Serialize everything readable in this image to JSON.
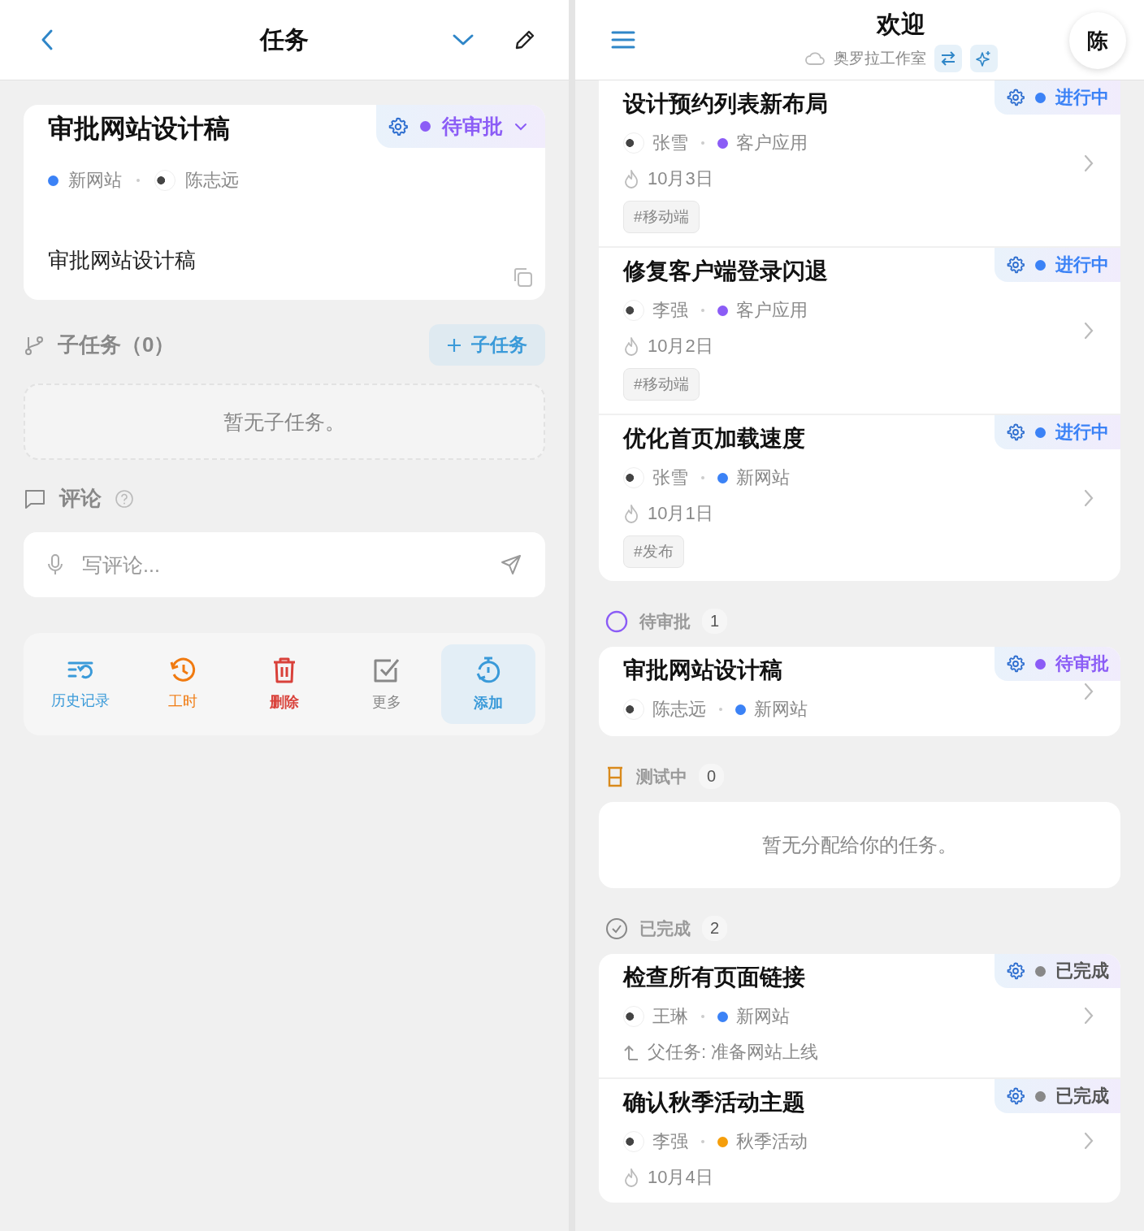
{
  "detail": {
    "header": {
      "title": "任务"
    },
    "task": {
      "title": "审批网站设计稿",
      "status": {
        "label": "待审批",
        "color": "#8b5cf6"
      },
      "project": {
        "name": "新网站",
        "color": "#3b82f6"
      },
      "assignee": "陈志远",
      "description": "审批网站设计稿"
    },
    "subtasks": {
      "title": "子任务（0）",
      "add_label": "子任务",
      "empty": "暂无子任务。"
    },
    "comments": {
      "title": "评论",
      "placeholder": "写评论..."
    },
    "actions": [
      {
        "label": "历史记录",
        "kind": "history",
        "selected": false
      },
      {
        "label": "工时",
        "kind": "timelog",
        "selected": false
      },
      {
        "label": "删除",
        "kind": "delete",
        "selected": false
      },
      {
        "label": "更多",
        "kind": "more",
        "selected": false
      },
      {
        "label": "添加",
        "kind": "add",
        "selected": true
      }
    ]
  },
  "home": {
    "header": {
      "title": "欢迎",
      "workspace": "奥罗拉工作室",
      "avatar": "陈"
    },
    "groups": [
      {
        "cards": [
          {
            "title": "设计预约列表新布局",
            "assignee": "张雪",
            "project": {
              "name": "客户应用",
              "color": "#8b5cf6"
            },
            "due": "10月3日",
            "tags": [
              "#移动端"
            ],
            "status": {
              "label": "进行中",
              "color": "#3b82f6"
            }
          },
          {
            "title": "修复客户端登录闪退",
            "assignee": "李强",
            "project": {
              "name": "客户应用",
              "color": "#8b5cf6"
            },
            "due": "10月2日",
            "tags": [
              "#移动端"
            ],
            "status": {
              "label": "进行中",
              "color": "#3b82f6"
            }
          },
          {
            "title": "优化首页加载速度",
            "assignee": "张雪",
            "project": {
              "name": "新网站",
              "color": "#3b82f6"
            },
            "due": "10月1日",
            "tags": [
              "#发布"
            ],
            "status": {
              "label": "进行中",
              "color": "#3b82f6"
            }
          }
        ]
      },
      {
        "kind": "pending",
        "title": "待审批",
        "count": "1",
        "cards": [
          {
            "title": "审批网站设计稿",
            "assignee": "陈志远",
            "project": {
              "name": "新网站",
              "color": "#3b82f6"
            },
            "status": {
              "label": "待审批",
              "color": "#8b5cf6"
            }
          }
        ]
      },
      {
        "kind": "testing",
        "title": "测试中",
        "count": "0",
        "empty": "暂无分配给你的任务。"
      },
      {
        "kind": "done",
        "title": "已完成",
        "count": "2",
        "cards": [
          {
            "title": "检查所有页面链接",
            "assignee": "王琳",
            "project": {
              "name": "新网站",
              "color": "#3b82f6"
            },
            "parent": "父任务: 准备网站上线",
            "status": {
              "label": "已完成",
              "color": "#888888"
            }
          },
          {
            "title": "确认秋季活动主题",
            "assignee": "李强",
            "project": {
              "name": "秋季活动",
              "color": "#f59e0b"
            },
            "due": "10月4日",
            "status": {
              "label": "已完成",
              "color": "#888888"
            }
          }
        ]
      }
    ]
  }
}
